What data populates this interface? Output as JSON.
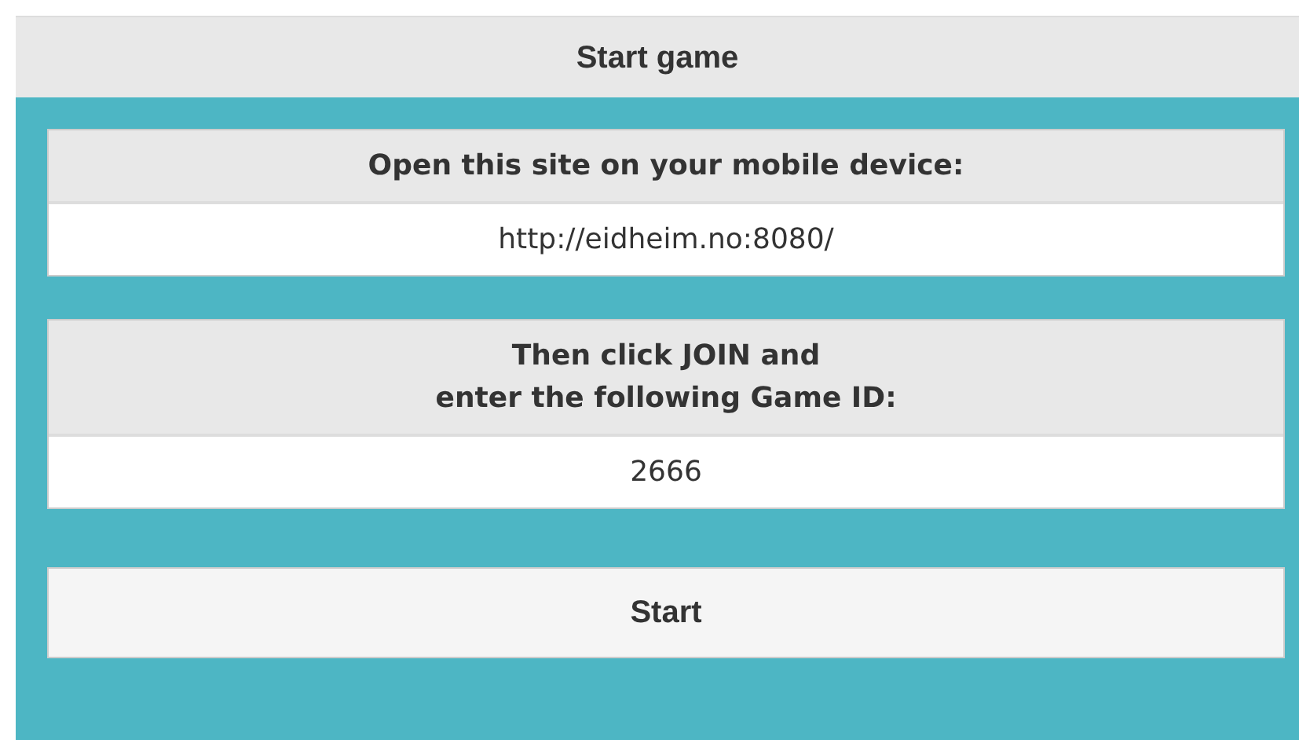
{
  "header": {
    "title": "Start game"
  },
  "panels": [
    {
      "heading": [
        "Open this site on your mobile device:"
      ],
      "value": "http://eidheim.no:8080/"
    },
    {
      "heading": [
        "Then click JOIN and",
        "enter the following Game ID:"
      ],
      "value": "2666"
    }
  ],
  "start_button": {
    "label": "Start"
  }
}
